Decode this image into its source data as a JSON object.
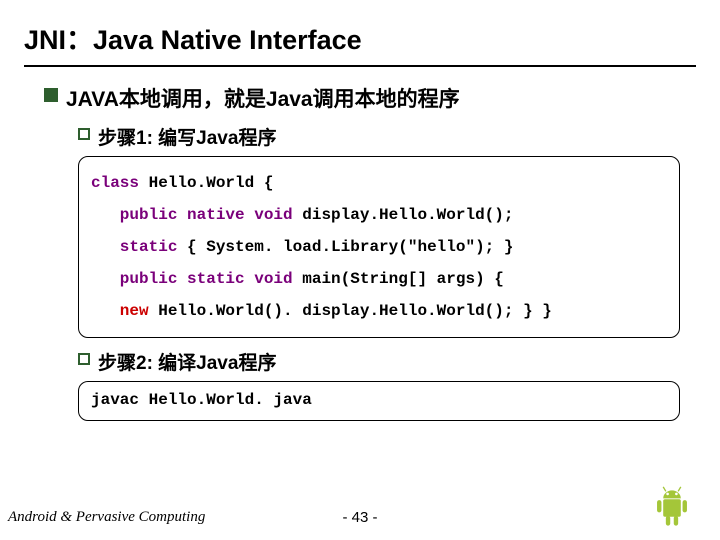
{
  "title": "JNI：Java Native Interface",
  "bullet1": "JAVA本地调用，就是Java调用本地的程序",
  "step1": "步骤1: 编写Java程序",
  "code1": {
    "l1a": "class",
    "l1b": " Hello.World {",
    "l2a": "   public native void",
    "l2b": " display.Hello.World();",
    "l3a": "   static",
    "l3b": " { System. load.Library(\"hello\"); }",
    "l4a": "   public static void",
    "l4b": " main(String[] args) {",
    "l5a": "   new",
    "l5b": " Hello.World(). display.Hello.World(); } }"
  },
  "step2": "步骤2: 编译Java程序",
  "code2": "javac Hello.World. java",
  "footer": "Android & Pervasive Computing",
  "page": "- 43 -"
}
